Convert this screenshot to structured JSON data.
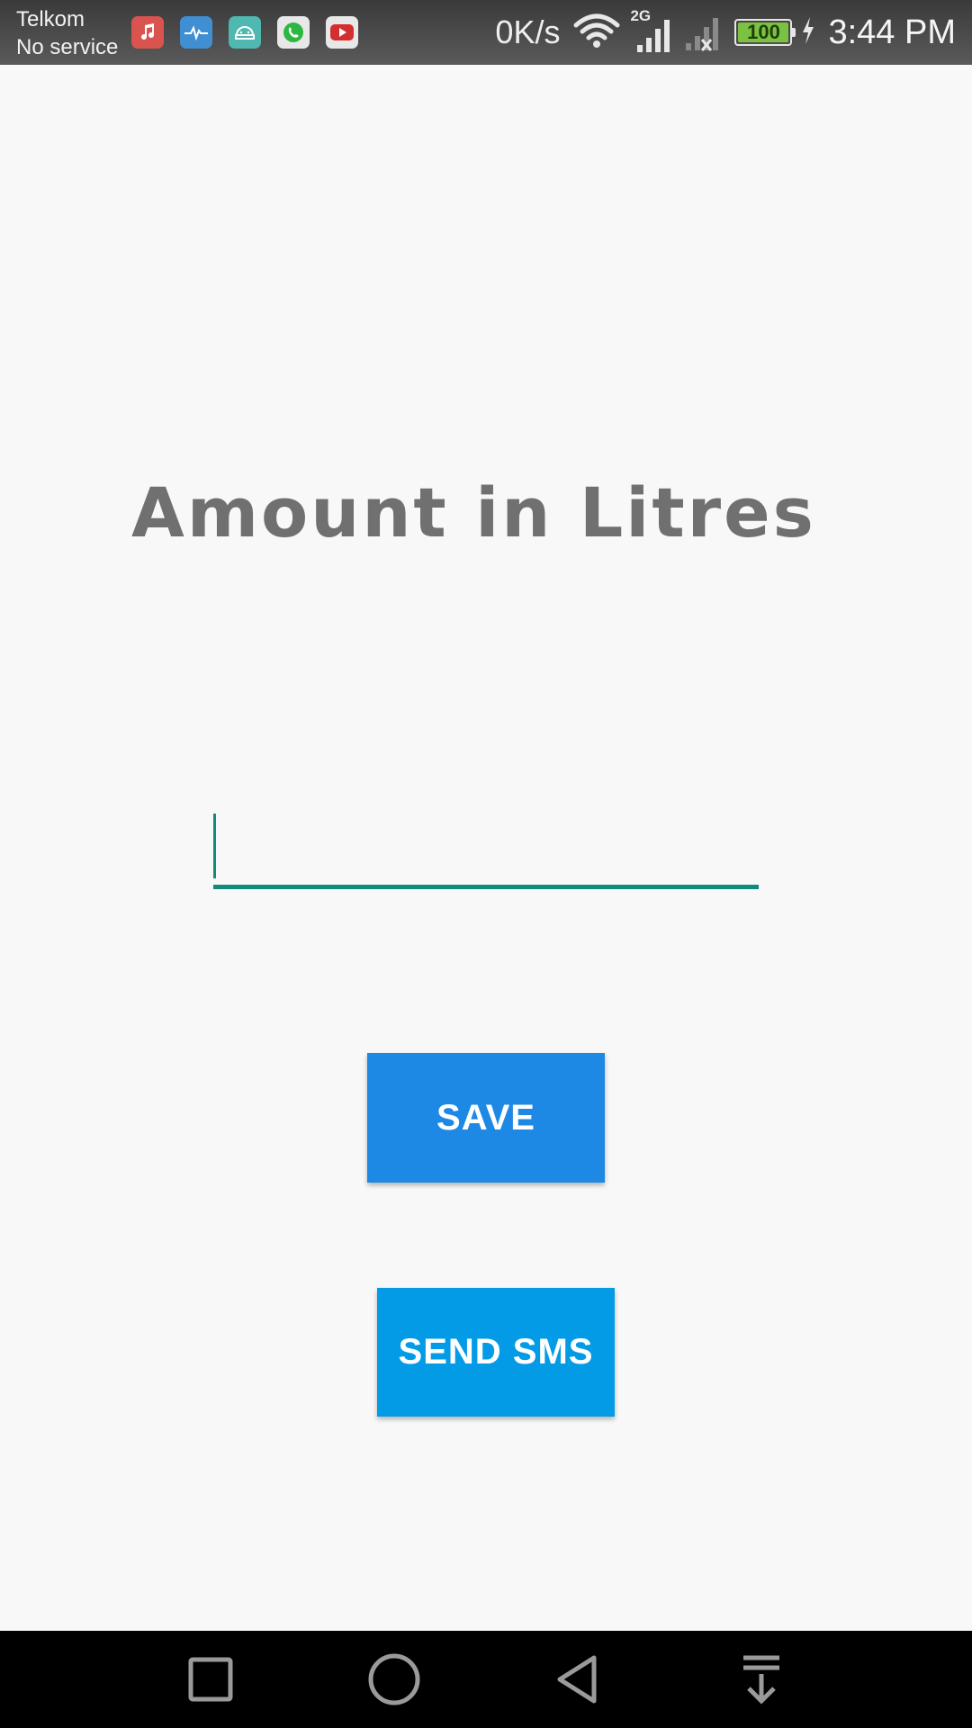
{
  "status_bar": {
    "carrier": "Telkom",
    "service": "No service",
    "app_icons": [
      {
        "name": "music-icon",
        "color": "#d9534f"
      },
      {
        "name": "health-icon",
        "color": "#3f8fd2"
      },
      {
        "name": "android-icon",
        "color": "#4fb8b0"
      },
      {
        "name": "whatsapp-icon",
        "color": "#e8e8e8"
      },
      {
        "name": "youtube-icon",
        "color": "#e8e8e8"
      }
    ],
    "net_speed": "0K/s",
    "network_type": "2G",
    "battery_level": "100",
    "time": "3:44 PM"
  },
  "main": {
    "heading": "Amount in Litres",
    "amount_input": {
      "value": "",
      "placeholder": ""
    },
    "save_label": "SAVE",
    "send_sms_label": "SEND SMS"
  },
  "nav_bar": {
    "items": [
      "recent-apps-icon",
      "home-icon",
      "back-icon",
      "notification-drawer-icon"
    ]
  },
  "colors": {
    "accent": "#138a7e",
    "save_button": "#1e88e5",
    "send_sms_button": "#039be5",
    "heading_text": "#707070",
    "background": "#f8f8f8"
  }
}
